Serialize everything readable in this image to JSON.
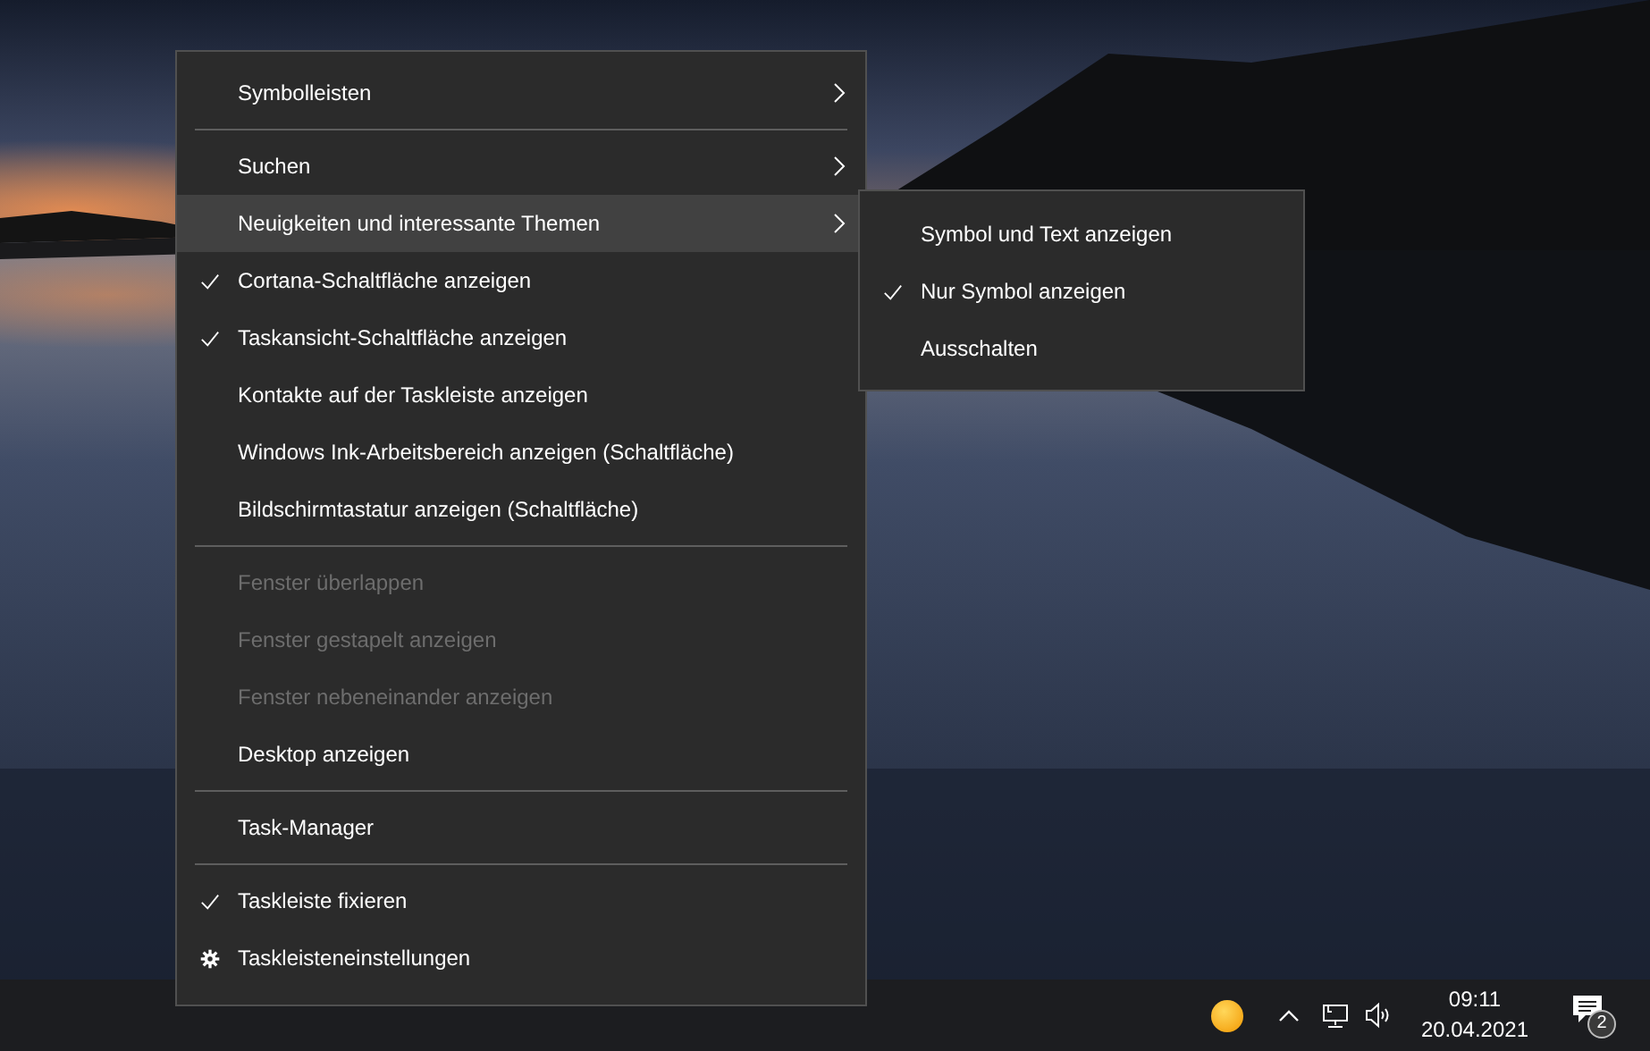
{
  "menu": {
    "items": [
      {
        "kind": "item",
        "label": "Symbolleisten",
        "submenu": true,
        "checked": false,
        "disabled": false,
        "highlighted": false
      },
      {
        "kind": "separator"
      },
      {
        "kind": "item",
        "label": "Suchen",
        "submenu": true,
        "checked": false,
        "disabled": false,
        "highlighted": false
      },
      {
        "kind": "item",
        "label": "Neuigkeiten und interessante Themen",
        "submenu": true,
        "checked": false,
        "disabled": false,
        "highlighted": true
      },
      {
        "kind": "item",
        "label": "Cortana-Schaltfläche anzeigen",
        "submenu": false,
        "checked": true,
        "disabled": false,
        "highlighted": false
      },
      {
        "kind": "item",
        "label": "Taskansicht-Schaltfläche anzeigen",
        "submenu": false,
        "checked": true,
        "disabled": false,
        "highlighted": false
      },
      {
        "kind": "item",
        "label": "Kontakte auf der Taskleiste anzeigen",
        "submenu": false,
        "checked": false,
        "disabled": false,
        "highlighted": false
      },
      {
        "kind": "item",
        "label": "Windows Ink-Arbeitsbereich anzeigen (Schaltfläche)",
        "submenu": false,
        "checked": false,
        "disabled": false,
        "highlighted": false
      },
      {
        "kind": "item",
        "label": "Bildschirmtastatur anzeigen (Schaltfläche)",
        "submenu": false,
        "checked": false,
        "disabled": false,
        "highlighted": false
      },
      {
        "kind": "separator"
      },
      {
        "kind": "item",
        "label": "Fenster überlappen",
        "submenu": false,
        "checked": false,
        "disabled": true,
        "highlighted": false
      },
      {
        "kind": "item",
        "label": "Fenster gestapelt anzeigen",
        "submenu": false,
        "checked": false,
        "disabled": true,
        "highlighted": false
      },
      {
        "kind": "item",
        "label": "Fenster nebeneinander anzeigen",
        "submenu": false,
        "checked": false,
        "disabled": true,
        "highlighted": false
      },
      {
        "kind": "item",
        "label": "Desktop anzeigen",
        "submenu": false,
        "checked": false,
        "disabled": false,
        "highlighted": false
      },
      {
        "kind": "separator"
      },
      {
        "kind": "item",
        "label": "Task-Manager",
        "submenu": false,
        "checked": false,
        "disabled": false,
        "highlighted": false
      },
      {
        "kind": "separator"
      },
      {
        "kind": "item",
        "label": "Taskleiste fixieren",
        "submenu": false,
        "checked": true,
        "disabled": false,
        "highlighted": false
      },
      {
        "kind": "settings",
        "label": "Taskleisteneinstellungen",
        "submenu": false,
        "checked": false,
        "disabled": false,
        "highlighted": false
      }
    ]
  },
  "submenu": {
    "items": [
      {
        "label": "Symbol und Text anzeigen",
        "checked": false
      },
      {
        "label": "Nur Symbol anzeigen",
        "checked": true
      },
      {
        "label": "Ausschalten",
        "checked": false
      }
    ]
  },
  "taskbar": {
    "time": "09:11",
    "date": "20.04.2021",
    "notification_count": "2"
  }
}
